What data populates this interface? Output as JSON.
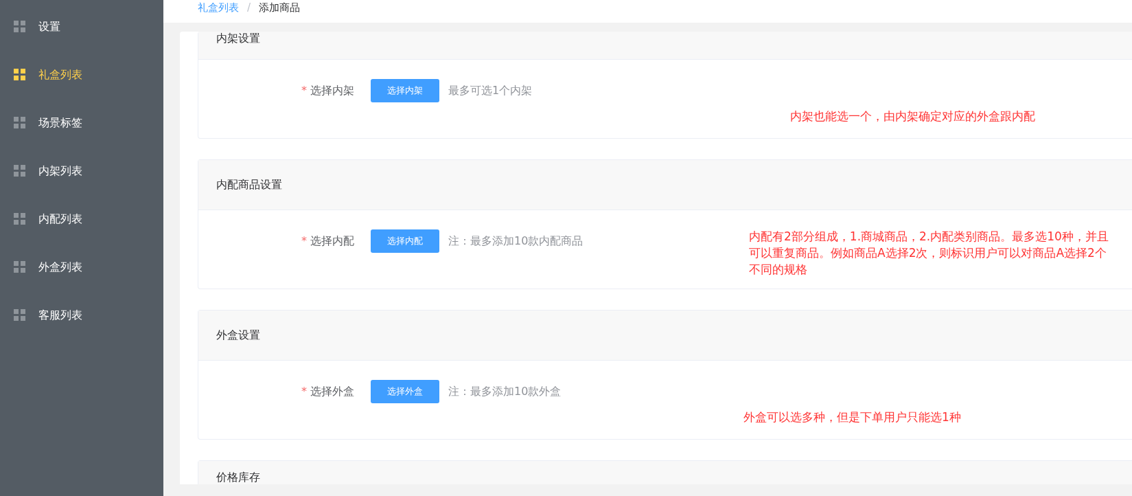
{
  "sidebar": {
    "items": [
      {
        "label": "设置",
        "selected": false
      },
      {
        "label": "礼盒列表",
        "selected": true
      },
      {
        "label": "场景标签",
        "selected": false
      },
      {
        "label": "内架列表",
        "selected": false
      },
      {
        "label": "内配列表",
        "selected": false
      },
      {
        "label": "外盒列表",
        "selected": false
      },
      {
        "label": "客服列表",
        "selected": false
      }
    ]
  },
  "breadcrumb": [
    {
      "label": "礼盒列表",
      "kind": "link"
    },
    {
      "label": "添加商品",
      "kind": "current"
    }
  ],
  "breadcrumb_separator": "/",
  "sections": [
    {
      "title": "内架设置",
      "field": {
        "label": "选择内架",
        "required_mark": "*",
        "button": "选择内架",
        "hint": "最多可选1个内架"
      },
      "note": "内架也能选一个，由内架确定对应的外盒跟内配"
    },
    {
      "title": "内配商品设置",
      "field": {
        "label": "选择内配",
        "required_mark": "*",
        "button": "选择内配",
        "hint": "注：最多添加10款内配商品"
      },
      "note": "内配有2部分组成，1.商城商品，2.内配类别商品。最多选10种，并且可以重复商品。例如商品A选择2次，则标识用户可以对商品A选择2个不同的规格"
    },
    {
      "title": "外盒设置",
      "field": {
        "label": "选择外盒",
        "required_mark": "*",
        "button": "选择外盒",
        "hint": "注：最多添加10款外盒"
      },
      "note": "外盒可以选多种，但是下单用户只能选1种"
    },
    {
      "title": "价格库存"
    }
  ]
}
